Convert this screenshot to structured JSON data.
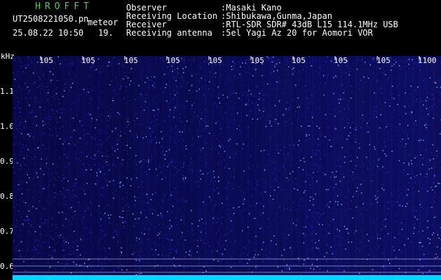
{
  "header": {
    "program": "HROFFT",
    "file_name": "UT2508221050.pn",
    "file_type": "meteor",
    "date_time": "25.08.22 10:50",
    "count": "19."
  },
  "info": [
    {
      "label": "Observer",
      "value": ":Masaki Kano"
    },
    {
      "label": "Receiving Location",
      "value": ":Shibukawa,Gunma,Japan"
    },
    {
      "label": "Receiver",
      "value": ":RTL-SDR SDR# 43dB L15 114.1MHz USB"
    },
    {
      "label": "Receiving antenna",
      "value": ":5el Yagi Az 20 for Aomori VOR"
    }
  ],
  "axis": {
    "y_unit": "kHz",
    "y_ticks": [
      "1.1",
      "1.0",
      "0.9",
      "0.8",
      "0.7",
      "0.6"
    ],
    "x_ticks": [
      "105",
      "105",
      "105",
      "105",
      "105",
      "105",
      "105",
      "105",
      "105",
      "1100"
    ]
  },
  "colors": {
    "background": "#000000",
    "spectrogram_bg": "#050535",
    "noise_low": "#1a1aa0",
    "noise_high": "#7fb0ff",
    "baseline": "#00d8ff",
    "program_green": "#3ddc3d"
  }
}
